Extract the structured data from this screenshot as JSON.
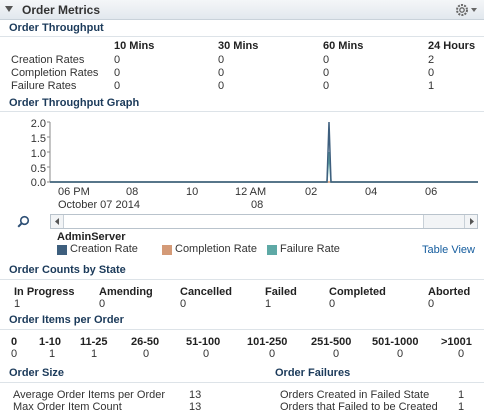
{
  "panel": {
    "title": "Order Metrics",
    "gear_icon": "gear-icon"
  },
  "throughput": {
    "title": "Order Throughput",
    "columns": [
      "10 Mins",
      "30 Mins",
      "60 Mins",
      "24 Hours"
    ],
    "rows": [
      {
        "label": "Creation Rates",
        "values": [
          "0",
          "0",
          "0",
          "2"
        ]
      },
      {
        "label": "Completion Rates",
        "values": [
          "0",
          "0",
          "0",
          "0"
        ]
      },
      {
        "label": "Failure Rates",
        "values": [
          "0",
          "0",
          "0",
          "1"
        ]
      }
    ]
  },
  "graph": {
    "title": "Order Throughput Graph",
    "server": "AdminServer",
    "table_view_link": "Table View"
  },
  "chart_data": {
    "type": "line",
    "y_ticks": [
      "2.0",
      "1.5",
      "1.0",
      "0.5",
      "0.0"
    ],
    "ylim": [
      0,
      2
    ],
    "x_ticks": [
      "06 PM",
      "08",
      "10",
      "12 AM",
      "02",
      "04",
      "06"
    ],
    "x_subtitles": [
      "October 07 2014",
      "08"
    ],
    "grid": false,
    "legend_position": "bottom",
    "series": [
      {
        "name": "Creation Rate",
        "color": "#3e5f7e",
        "peak": 2
      },
      {
        "name": "Completion Rate",
        "color": "#d49a77",
        "peak": 0
      },
      {
        "name": "Failure Rate",
        "color": "#5ea9a6",
        "peak": 1
      }
    ]
  },
  "counts_by_state": {
    "title": "Order Counts by State",
    "items": [
      {
        "label": "In Progress",
        "value": "1"
      },
      {
        "label": "Amending",
        "value": "0"
      },
      {
        "label": "Cancelled",
        "value": "0"
      },
      {
        "label": "Failed",
        "value": "1"
      },
      {
        "label": "Completed",
        "value": "0"
      },
      {
        "label": "Aborted",
        "value": "0"
      }
    ]
  },
  "items_per_order": {
    "title": "Order Items per Order",
    "items": [
      {
        "label": "0",
        "value": "0"
      },
      {
        "label": "1-10",
        "value": "1"
      },
      {
        "label": "11-25",
        "value": "1"
      },
      {
        "label": "26-50",
        "value": "0"
      },
      {
        "label": "51-100",
        "value": "0"
      },
      {
        "label": "101-250",
        "value": "0"
      },
      {
        "label": "251-500",
        "value": "0"
      },
      {
        "label": "501-1000",
        "value": "0"
      },
      {
        "label": ">1001",
        "value": "0"
      }
    ]
  },
  "order_size": {
    "title": "Order Size",
    "rows": [
      {
        "label": "Average Order Items per Order",
        "value": "13"
      },
      {
        "label": "Max Order Item Count",
        "value": "13"
      }
    ]
  },
  "order_failures": {
    "title": "Order Failures",
    "rows": [
      {
        "label": "Orders Created in Failed State",
        "value": "1"
      },
      {
        "label": "Orders that Failed to be Created",
        "value": "1"
      }
    ]
  }
}
